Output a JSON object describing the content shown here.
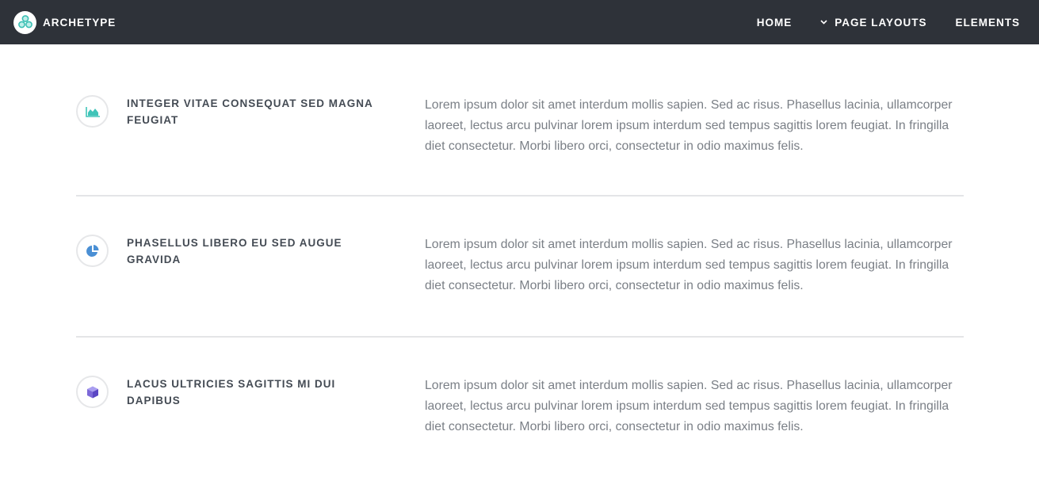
{
  "brand": {
    "name": "ARCHETYPE",
    "logo_icon": "cubes-logo-icon",
    "logo_color": "#3bbfb4"
  },
  "nav": {
    "items": [
      {
        "label": "HOME"
      },
      {
        "label": "PAGE LAYOUTS",
        "icon": "chevron-down-icon"
      },
      {
        "label": "ELEMENTS"
      }
    ]
  },
  "features": [
    {
      "icon": "area-chart-icon",
      "icon_color": "#3fc4b8",
      "title": "INTEGER VITAE CONSEQUAT SED MAGNA FEUGIAT",
      "text": "Lorem ipsum dolor sit amet interdum mollis sapien. Sed ac risus. Phasellus lacinia, ullamcorper laoreet, lectus arcu pulvinar lorem ipsum interdum sed tempus sagittis lorem feugiat. In fringilla diet consectetur. Morbi libero orci, consectetur in odio maximus felis."
    },
    {
      "icon": "pie-chart-icon",
      "icon_color": "#4a8fd4",
      "title": "PHASELLUS LIBERO EU SED AUGUE GRAVIDA",
      "text": "Lorem ipsum dolor sit amet interdum mollis sapien. Sed ac risus. Phasellus lacinia, ullamcorper laoreet, lectus arcu pulvinar lorem ipsum interdum sed tempus sagittis lorem feugiat. In fringilla diet consectetur. Morbi libero orci, consectetur in odio maximus felis."
    },
    {
      "icon": "cube-icon",
      "icon_color": "#7c68d8",
      "title": "LACUS ULTRICIES SAGITTIS MI DUI DAPIBUS",
      "text": "Lorem ipsum dolor sit amet interdum mollis sapien. Sed ac risus. Phasellus lacinia, ullamcorper laoreet, lectus arcu pulvinar lorem ipsum interdum sed tempus sagittis lorem feugiat. In fringilla diet consectetur. Morbi libero orci, consectetur in odio maximus felis."
    }
  ]
}
